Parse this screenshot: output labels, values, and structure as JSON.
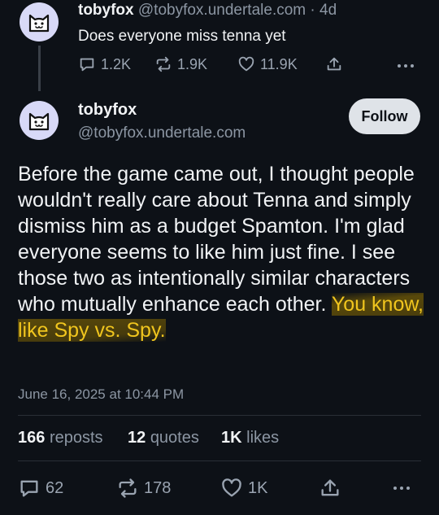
{
  "reply_post": {
    "display_name": "tobyfox",
    "handle": "@tobyfox.undertale.com",
    "separator": "·",
    "time_ago": "4d",
    "text": "Does everyone miss tenna yet",
    "replies": "1.2K",
    "reposts": "1.9K",
    "likes": "11.9K"
  },
  "main_post": {
    "display_name": "tobyfox",
    "handle": "@tobyfox.undertale.com",
    "follow_label": "Follow",
    "text_plain": "Before the game came out, I thought people wouldn't really care about Tenna and simply dismiss him as a budget Spamton. I'm glad everyone seems to like him just fine. I see those two as intentionally similar characters who mutually enhance each other. ",
    "text_highlight": "You know, like Spy vs. Spy.",
    "timestamp": "June 16, 2025 at 10:44 PM",
    "stats": {
      "reposts_count": "166",
      "reposts_label": "reposts",
      "quotes_count": "12",
      "quotes_label": "quotes",
      "likes_count": "1K",
      "likes_label": "likes"
    },
    "actions": {
      "replies": "62",
      "reposts": "178",
      "likes": "1K"
    }
  },
  "colors": {
    "background": "#0d1117",
    "highlight_text": "#f0c51e",
    "avatar_bg": "#d8d9f7",
    "follow_bg": "#dfe3e8"
  },
  "icons": [
    "cat-avatar-icon",
    "reply-icon",
    "repost-icon",
    "heart-icon",
    "share-icon",
    "more-icon"
  ]
}
